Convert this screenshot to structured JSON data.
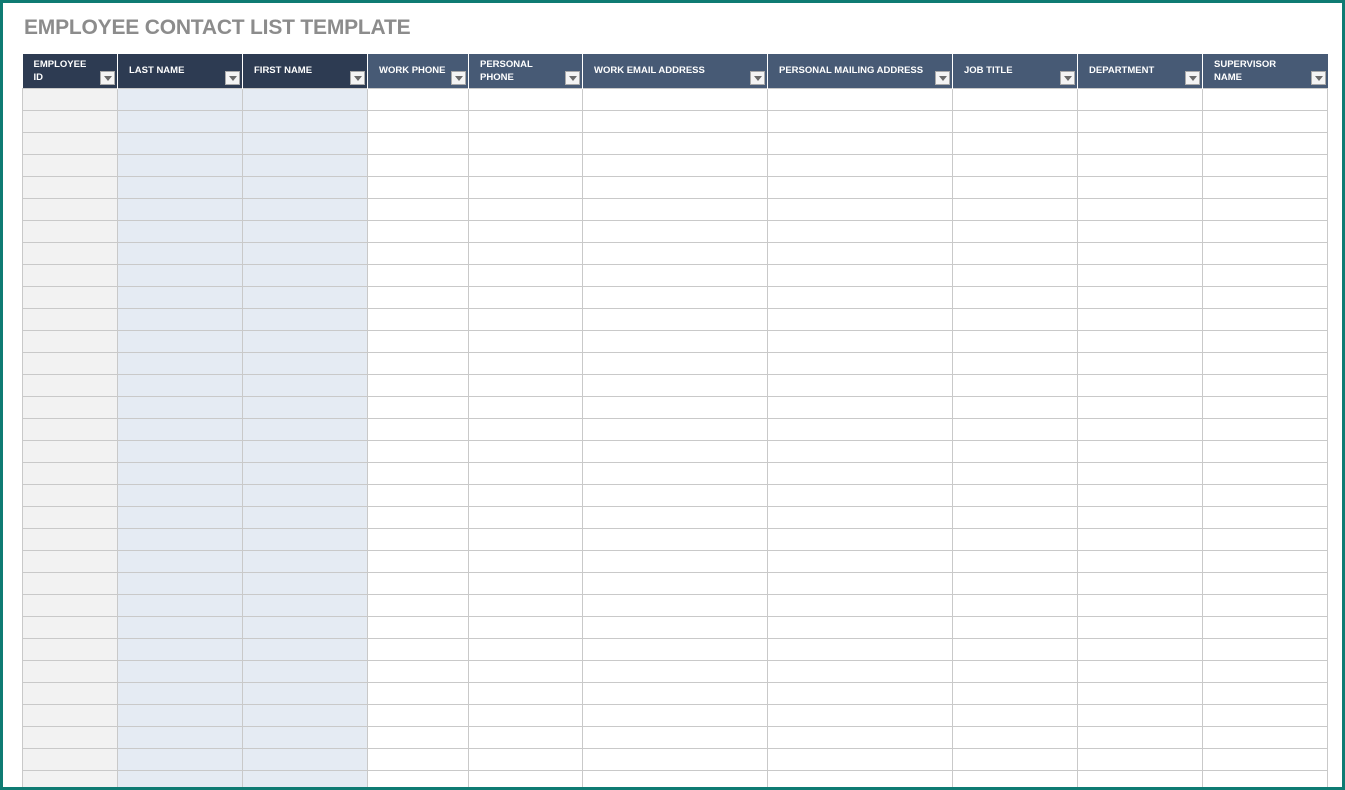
{
  "title": "EMPLOYEE CONTACT LIST TEMPLATE",
  "columns": [
    {
      "key": "employee_id",
      "label": "EMPLOYEE ID",
      "style": "dark"
    },
    {
      "key": "last_name",
      "label": "LAST NAME",
      "style": "dark"
    },
    {
      "key": "first_name",
      "label": "FIRST NAME",
      "style": "dark"
    },
    {
      "key": "work_phone",
      "label": "WORK PHONE",
      "style": "mid"
    },
    {
      "key": "personal_phone",
      "label": "PERSONAL PHONE",
      "style": "mid"
    },
    {
      "key": "work_email",
      "label": "WORK EMAIL ADDRESS",
      "style": "mid"
    },
    {
      "key": "personal_mailing",
      "label": "PERSONAL MAILING ADDRESS",
      "style": "mid"
    },
    {
      "key": "job_title",
      "label": "JOB TITLE",
      "style": "mid"
    },
    {
      "key": "department",
      "label": "DEPARTMENT",
      "style": "mid"
    },
    {
      "key": "supervisor_name",
      "label": "SUPERVISOR NAME",
      "style": "mid"
    }
  ],
  "rows": [
    [
      "",
      "",
      "",
      "",
      "",
      "",
      "",
      "",
      "",
      ""
    ],
    [
      "",
      "",
      "",
      "",
      "",
      "",
      "",
      "",
      "",
      ""
    ],
    [
      "",
      "",
      "",
      "",
      "",
      "",
      "",
      "",
      "",
      ""
    ],
    [
      "",
      "",
      "",
      "",
      "",
      "",
      "",
      "",
      "",
      ""
    ],
    [
      "",
      "",
      "",
      "",
      "",
      "",
      "",
      "",
      "",
      ""
    ],
    [
      "",
      "",
      "",
      "",
      "",
      "",
      "",
      "",
      "",
      ""
    ],
    [
      "",
      "",
      "",
      "",
      "",
      "",
      "",
      "",
      "",
      ""
    ],
    [
      "",
      "",
      "",
      "",
      "",
      "",
      "",
      "",
      "",
      ""
    ],
    [
      "",
      "",
      "",
      "",
      "",
      "",
      "",
      "",
      "",
      ""
    ],
    [
      "",
      "",
      "",
      "",
      "",
      "",
      "",
      "",
      "",
      ""
    ],
    [
      "",
      "",
      "",
      "",
      "",
      "",
      "",
      "",
      "",
      ""
    ],
    [
      "",
      "",
      "",
      "",
      "",
      "",
      "",
      "",
      "",
      ""
    ],
    [
      "",
      "",
      "",
      "",
      "",
      "",
      "",
      "",
      "",
      ""
    ],
    [
      "",
      "",
      "",
      "",
      "",
      "",
      "",
      "",
      "",
      ""
    ],
    [
      "",
      "",
      "",
      "",
      "",
      "",
      "",
      "",
      "",
      ""
    ],
    [
      "",
      "",
      "",
      "",
      "",
      "",
      "",
      "",
      "",
      ""
    ],
    [
      "",
      "",
      "",
      "",
      "",
      "",
      "",
      "",
      "",
      ""
    ],
    [
      "",
      "",
      "",
      "",
      "",
      "",
      "",
      "",
      "",
      ""
    ],
    [
      "",
      "",
      "",
      "",
      "",
      "",
      "",
      "",
      "",
      ""
    ],
    [
      "",
      "",
      "",
      "",
      "",
      "",
      "",
      "",
      "",
      ""
    ],
    [
      "",
      "",
      "",
      "",
      "",
      "",
      "",
      "",
      "",
      ""
    ],
    [
      "",
      "",
      "",
      "",
      "",
      "",
      "",
      "",
      "",
      ""
    ],
    [
      "",
      "",
      "",
      "",
      "",
      "",
      "",
      "",
      "",
      ""
    ],
    [
      "",
      "",
      "",
      "",
      "",
      "",
      "",
      "",
      "",
      ""
    ],
    [
      "",
      "",
      "",
      "",
      "",
      "",
      "",
      "",
      "",
      ""
    ],
    [
      "",
      "",
      "",
      "",
      "",
      "",
      "",
      "",
      "",
      ""
    ],
    [
      "",
      "",
      "",
      "",
      "",
      "",
      "",
      "",
      "",
      ""
    ],
    [
      "",
      "",
      "",
      "",
      "",
      "",
      "",
      "",
      "",
      ""
    ],
    [
      "",
      "",
      "",
      "",
      "",
      "",
      "",
      "",
      "",
      ""
    ],
    [
      "",
      "",
      "",
      "",
      "",
      "",
      "",
      "",
      "",
      ""
    ],
    [
      "",
      "",
      "",
      "",
      "",
      "",
      "",
      "",
      "",
      ""
    ],
    [
      "",
      "",
      "",
      "",
      "",
      "",
      "",
      "",
      "",
      ""
    ],
    [
      "",
      "",
      "",
      "",
      "",
      "",
      "",
      "",
      "",
      ""
    ]
  ],
  "colors": {
    "header_dark": "#2d3b52",
    "header_mid": "#475a75",
    "id_column_fill": "#f2f2f2",
    "name_column_fill": "#e5ebf3",
    "title_text": "#8c8c8c",
    "frame_border": "#0f7b73"
  }
}
